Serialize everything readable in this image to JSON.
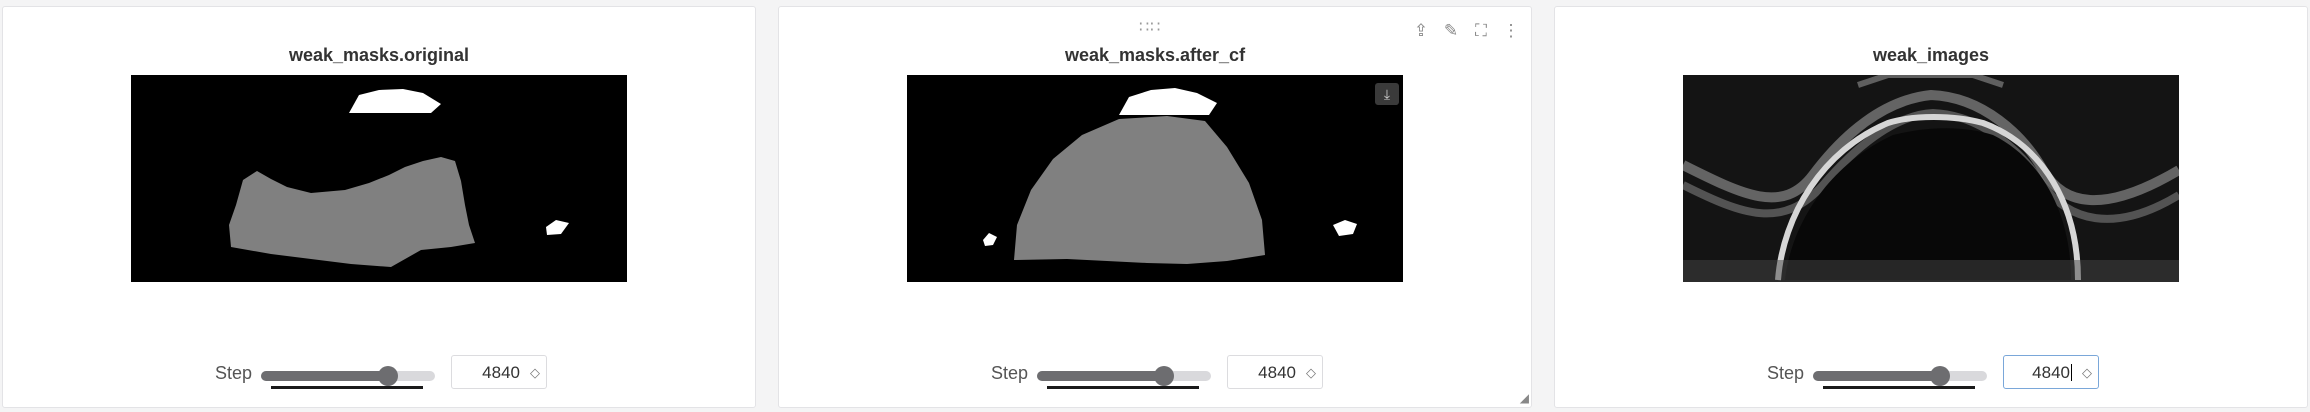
{
  "panels": [
    {
      "title": "weak_masks.original",
      "step_label": "Step",
      "step_value": "4840",
      "slider_fraction": 0.73,
      "active_toolbar": false
    },
    {
      "title": "weak_masks.after_cf",
      "step_label": "Step",
      "step_value": "4840",
      "slider_fraction": 0.73,
      "active_toolbar": true,
      "toolbar_icons": [
        "share-icon",
        "edit-icon",
        "fullscreen-icon",
        "more-icon"
      ]
    },
    {
      "title": "weak_images",
      "step_label": "Step",
      "step_value": "4840",
      "slider_fraction": 0.73,
      "active_toolbar": false
    }
  ],
  "icons": {
    "spin": "◇",
    "share": "⇪",
    "edit": "✎",
    "fullscreen": "⛶",
    "more": "⋮",
    "drag": "∷∷",
    "download": "⤓",
    "resize": "◢"
  },
  "colors": {
    "mask_gray": "#808080",
    "mask_white": "#ffffff",
    "background": "#000000"
  }
}
